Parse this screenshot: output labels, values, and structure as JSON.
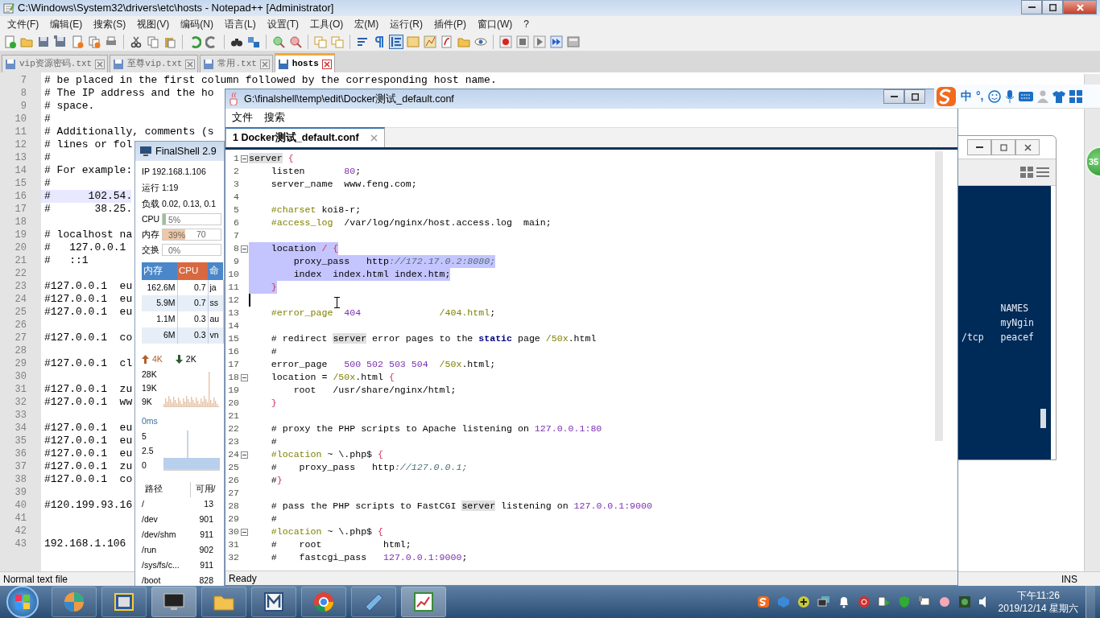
{
  "notepad": {
    "title": "C:\\Windows\\System32\\drivers\\etc\\hosts - Notepad++ [Administrator]",
    "menu": [
      "文件(F)",
      "编辑(E)",
      "搜索(S)",
      "视图(V)",
      "编码(N)",
      "语言(L)",
      "设置(T)",
      "工具(O)",
      "宏(M)",
      "运行(R)",
      "插件(P)",
      "窗口(W)",
      "?"
    ],
    "tabs": [
      {
        "label": "vip资源密码.txt",
        "selected": false
      },
      {
        "label": "至尊vip.txt",
        "selected": false
      },
      {
        "label": "常用.txt",
        "selected": false
      },
      {
        "label": "hosts",
        "selected": true
      }
    ],
    "lines": [
      {
        "number": "7",
        "text": "# be placed in the first column followed by the corresponding host name.",
        "current": false
      },
      {
        "number": "8",
        "text": "# The IP address and the ho",
        "current": false
      },
      {
        "number": "9",
        "text": "# space.",
        "current": false
      },
      {
        "number": "10",
        "text": "#",
        "current": false
      },
      {
        "number": "11",
        "text": "# Additionally, comments (s",
        "current": false
      },
      {
        "number": "12",
        "text": "# lines or fol",
        "current": false
      },
      {
        "number": "13",
        "text": "#",
        "current": false
      },
      {
        "number": "14",
        "text": "# For example:",
        "current": false
      },
      {
        "number": "15",
        "text": "#",
        "current": false
      },
      {
        "number": "16",
        "text": "#      102.54.",
        "current": true
      },
      {
        "number": "17",
        "text": "#       38.25.",
        "current": false
      },
      {
        "number": "18",
        "current": false
      },
      {
        "number": "19",
        "text": "# localhost na",
        "current": false
      },
      {
        "number": "20",
        "text": "#   127.0.0.1",
        "current": false
      },
      {
        "number": "21",
        "text": "#   ::1",
        "current": false
      },
      {
        "number": "22",
        "current": false
      },
      {
        "number": "23",
        "text": "#127.0.0.1  eu",
        "current": false
      },
      {
        "number": "24",
        "text": "#127.0.0.1  eu",
        "current": false
      },
      {
        "number": "25",
        "text": "#127.0.0.1  eu",
        "current": false
      },
      {
        "number": "26",
        "current": false
      },
      {
        "number": "27",
        "text": "#127.0.0.1  co",
        "current": false
      },
      {
        "number": "28",
        "current": false
      },
      {
        "number": "29",
        "text": "#127.0.0.1  cl",
        "current": false
      },
      {
        "number": "30",
        "current": false
      },
      {
        "number": "31",
        "text": "#127.0.0.1  zu",
        "current": false
      },
      {
        "number": "32",
        "text": "#127.0.0.1  ww",
        "current": false
      },
      {
        "number": "33",
        "current": false
      },
      {
        "number": "34",
        "text": "#127.0.0.1  eu",
        "current": false
      },
      {
        "number": "35",
        "text": "#127.0.0.1  eu",
        "current": false
      },
      {
        "number": "36",
        "text": "#127.0.0.1  eu",
        "current": false
      },
      {
        "number": "37",
        "text": "#127.0.0.1  zu",
        "current": false
      },
      {
        "number": "38",
        "text": "#127.0.0.1  co",
        "current": false
      },
      {
        "number": "39",
        "current": false
      },
      {
        "number": "40",
        "text": "#120.199.93.16",
        "current": false
      },
      {
        "number": "41",
        "current": false
      },
      {
        "number": "42",
        "current": false
      },
      {
        "number": "43",
        "text": "192.168.1.106",
        "current": false
      }
    ],
    "status": {
      "file_type": "Normal text file",
      "mode": "INS"
    }
  },
  "finalshell": {
    "title": "FinalShell 2.9",
    "ip": "IP 192.168.1.106",
    "uptime": "运行 1:19",
    "load": "负载 0.02, 0.13, 0.1",
    "meters": [
      {
        "label": "CPU",
        "reading": "5%",
        "level": 0.05
      },
      {
        "label": "内存",
        "reading": "39%",
        "extra": "70",
        "level": 0.39
      },
      {
        "label": "交换",
        "reading": "0%",
        "level": 0
      }
    ],
    "process_table": {
      "columns": [
        "内存",
        "CPU",
        "命"
      ],
      "rows": [
        [
          "162.6M",
          "0.7",
          "ja"
        ],
        [
          "5.9M",
          "0.7",
          "ss"
        ],
        [
          "1.1M",
          "0.3",
          "au"
        ],
        [
          "6M",
          "0.3",
          "vn"
        ]
      ]
    },
    "network": {
      "up": "4K",
      "down": "2K",
      "ticks": [
        "28K",
        "19K",
        "9K"
      ]
    },
    "ping": {
      "label": "0ms",
      "ticks": [
        "5",
        "2.5",
        "0"
      ]
    },
    "disk_table": {
      "columns": [
        "路径",
        "可用/"
      ],
      "rows": [
        [
          "/",
          "13"
        ],
        [
          "/dev",
          "901"
        ],
        [
          "/dev/shm",
          "911"
        ],
        [
          "/run",
          "902"
        ],
        [
          "/sys/fs/c...",
          "911"
        ],
        [
          "/boot",
          "828"
        ]
      ]
    }
  },
  "editor": {
    "title": "G:\\finalshell\\temp\\edit\\Docker测试_default.conf",
    "menu": [
      "文件",
      "搜索"
    ],
    "tabs": [
      {
        "label": "1 Docker测试_default.conf",
        "selected": true
      }
    ],
    "lines": [
      {
        "n": "1",
        "fold": true,
        "selected": false,
        "current": false,
        "tokens": [
          {
            "kind": "match",
            "text": "server"
          },
          {
            "kind": "brace",
            "text": " {"
          }
        ]
      },
      {
        "n": "2",
        "fold": false,
        "selected": false,
        "current": false,
        "tokens": [
          {
            "kind": "plain",
            "text": "    listen       "
          },
          {
            "kind": "number",
            "text": "80"
          },
          {
            "kind": "plain",
            "text": ";"
          }
        ]
      },
      {
        "n": "3",
        "fold": false,
        "selected": false,
        "current": false,
        "tokens": [
          {
            "kind": "plain",
            "text": "    server_name  www.feng.com;"
          }
        ]
      },
      {
        "n": "4",
        "fold": false,
        "selected": false,
        "current": false
      },
      {
        "n": "5",
        "fold": false,
        "selected": false,
        "current": false,
        "tokens": [
          {
            "kind": "directive",
            "text": "    #charset"
          },
          {
            "kind": "plain",
            "text": " koi8-r;"
          }
        ]
      },
      {
        "n": "6",
        "fold": false,
        "selected": false,
        "current": false,
        "tokens": [
          {
            "kind": "directive",
            "text": "    #access_log"
          },
          {
            "kind": "plain",
            "text": "  /var/log/nginx/host.access.log  main;"
          }
        ]
      },
      {
        "n": "7",
        "fold": false,
        "selected": false,
        "current": false
      },
      {
        "n": "8",
        "fold": true,
        "selected": true,
        "current": false,
        "tokens": [
          {
            "kind": "plain",
            "text": "    location "
          },
          {
            "kind": "brace",
            "text": "/ {"
          }
        ]
      },
      {
        "n": "9",
        "fold": false,
        "selected": true,
        "current": false,
        "tokens": [
          {
            "kind": "plain",
            "text": "        proxy_pass   http"
          },
          {
            "kind": "url",
            "text": "://172.17.0.2:8080;"
          }
        ]
      },
      {
        "n": "10",
        "fold": false,
        "selected": true,
        "current": false,
        "tokens": [
          {
            "kind": "plain",
            "text": "        index  index.html index.htm;"
          }
        ]
      },
      {
        "n": "11",
        "fold": false,
        "selected": true,
        "current": false,
        "tokens": [
          {
            "kind": "brace",
            "text": "    }"
          }
        ]
      },
      {
        "n": "12",
        "fold": false,
        "selected": false,
        "current": true
      },
      {
        "n": "13",
        "fold": false,
        "selected": false,
        "current": false,
        "tokens": [
          {
            "kind": "directive",
            "text": "    #error_page  "
          },
          {
            "kind": "number",
            "text": "404"
          },
          {
            "kind": "directive",
            "text": "              /404.html"
          },
          {
            "kind": "plain",
            "text": ";"
          }
        ]
      },
      {
        "n": "14",
        "fold": false,
        "selected": false,
        "current": false
      },
      {
        "n": "15",
        "fold": false,
        "selected": false,
        "current": false,
        "tokens": [
          {
            "kind": "plain",
            "text": "    # redirect "
          },
          {
            "kind": "match",
            "text": "server"
          },
          {
            "kind": "plain",
            "text": " error pages to the "
          },
          {
            "kind": "keyword",
            "text": "static"
          },
          {
            "kind": "plain",
            "text": " page "
          },
          {
            "kind": "directive",
            "text": "/50x"
          },
          {
            "kind": "plain",
            "text": ".html"
          }
        ]
      },
      {
        "n": "16",
        "fold": false,
        "selected": false,
        "current": false,
        "tokens": [
          {
            "kind": "plain",
            "text": "    #"
          }
        ]
      },
      {
        "n": "17",
        "fold": false,
        "selected": false,
        "current": false,
        "tokens": [
          {
            "kind": "plain",
            "text": "    error_page   "
          },
          {
            "kind": "number",
            "text": "500 502 503 504"
          },
          {
            "kind": "directive",
            "text": "  /50x"
          },
          {
            "kind": "plain",
            "text": ".html;"
          }
        ]
      },
      {
        "n": "18",
        "fold": true,
        "selected": false,
        "current": false,
        "tokens": [
          {
            "kind": "plain",
            "text": "    location = "
          },
          {
            "kind": "directive",
            "text": "/50x"
          },
          {
            "kind": "plain",
            "text": ".html"
          },
          {
            "kind": "brace",
            "text": " {"
          }
        ]
      },
      {
        "n": "19",
        "fold": false,
        "selected": false,
        "current": false,
        "tokens": [
          {
            "kind": "plain",
            "text": "        root   /usr/share/nginx/html;"
          }
        ]
      },
      {
        "n": "20",
        "fold": false,
        "selected": false,
        "current": false,
        "tokens": [
          {
            "kind": "brace",
            "text": "    }"
          }
        ]
      },
      {
        "n": "21",
        "fold": false,
        "selected": false,
        "current": false
      },
      {
        "n": "22",
        "fold": false,
        "selected": false,
        "current": false,
        "tokens": [
          {
            "kind": "plain",
            "text": "    # proxy the PHP scripts to Apache listening on "
          },
          {
            "kind": "number",
            "text": "127.0.0.1:80"
          }
        ]
      },
      {
        "n": "23",
        "fold": false,
        "selected": false,
        "current": false,
        "tokens": [
          {
            "kind": "plain",
            "text": "    #"
          }
        ]
      },
      {
        "n": "24",
        "fold": true,
        "selected": false,
        "current": false,
        "tokens": [
          {
            "kind": "directive",
            "text": "    #location"
          },
          {
            "kind": "plain",
            "text": " ~ \\.php$"
          },
          {
            "kind": "brace",
            "text": " {"
          }
        ]
      },
      {
        "n": "25",
        "fold": false,
        "selected": false,
        "current": false,
        "tokens": [
          {
            "kind": "plain",
            "text": "    #    proxy_pass   http"
          },
          {
            "kind": "url",
            "text": "://127.0.0.1;"
          }
        ]
      },
      {
        "n": "26",
        "fold": false,
        "selected": false,
        "current": false,
        "tokens": [
          {
            "kind": "plain",
            "text": "    #"
          },
          {
            "kind": "brace",
            "text": "}"
          }
        ]
      },
      {
        "n": "27",
        "fold": false,
        "selected": false,
        "current": false
      },
      {
        "n": "28",
        "fold": false,
        "selected": false,
        "current": false,
        "tokens": [
          {
            "kind": "plain",
            "text": "    # pass the PHP scripts to FastCGI "
          },
          {
            "kind": "match",
            "text": "server"
          },
          {
            "kind": "plain",
            "text": " listening on "
          },
          {
            "kind": "number",
            "text": "127.0.0.1:9000"
          }
        ]
      },
      {
        "n": "29",
        "fold": false,
        "selected": false,
        "current": false,
        "tokens": [
          {
            "kind": "plain",
            "text": "    #"
          }
        ]
      },
      {
        "n": "30",
        "fold": true,
        "selected": false,
        "current": false,
        "tokens": [
          {
            "kind": "directive",
            "text": "    #location"
          },
          {
            "kind": "plain",
            "text": " ~ \\.php$"
          },
          {
            "kind": "brace",
            "text": " {"
          }
        ]
      },
      {
        "n": "31",
        "fold": false,
        "selected": false,
        "current": false,
        "tokens": [
          {
            "kind": "plain",
            "text": "    #    root           html;"
          }
        ]
      },
      {
        "n": "32",
        "fold": false,
        "selected": false,
        "current": false,
        "tokens": [
          {
            "kind": "plain",
            "text": "    #    fastcgi_pass   "
          },
          {
            "kind": "number",
            "text": "127.0.0.1:9000"
          },
          {
            "kind": "plain",
            "text": ";"
          }
        ]
      }
    ],
    "status": "Ready"
  },
  "terminal": {
    "lines": [
      "       NAMES",
      "       myNgin",
      "/tcp   peacef"
    ]
  },
  "ime": {
    "labels": [
      "中",
      "°,"
    ]
  },
  "notification_badge": "35",
  "taskbar": {
    "time": "下午11:26",
    "date": "2019/12/14 星期六"
  }
}
